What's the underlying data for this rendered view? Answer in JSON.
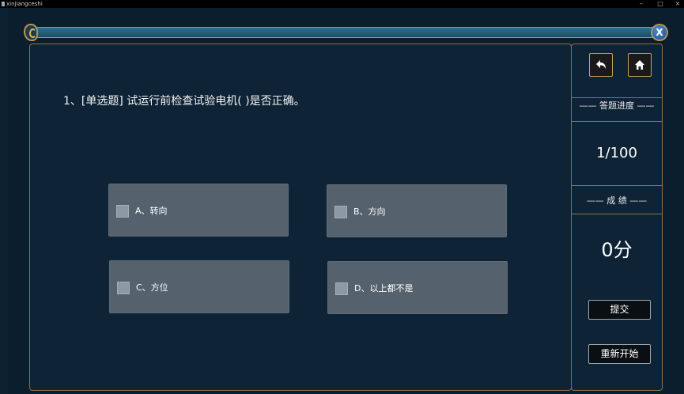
{
  "window": {
    "title": "xinjiangceshi",
    "minimize": "–",
    "maximize": "□",
    "close": "×"
  },
  "question": {
    "text": "1、[单选题] 试运行前检查试验电机(    )是否正确。",
    "options": [
      {
        "label": "A、转向",
        "checked": false
      },
      {
        "label": "B、方向",
        "checked": false
      },
      {
        "label": "C、方位",
        "checked": false
      },
      {
        "label": "D、以上都不是",
        "checked": false
      }
    ]
  },
  "panel": {
    "close_label": "X",
    "progress_heading": "—— 答题进度 ——",
    "progress_value": "1/100",
    "score_heading": "——  成    绩  ——",
    "score_value": "0分",
    "submit_label": "提交",
    "restart_label": "重新开始",
    "back_icon": "back-arrow-icon",
    "home_icon": "home-icon"
  },
  "colors": {
    "background": "#0c2132",
    "option_bg": "#55626d",
    "gold_border": "#b69457",
    "text": "#ffffff"
  }
}
